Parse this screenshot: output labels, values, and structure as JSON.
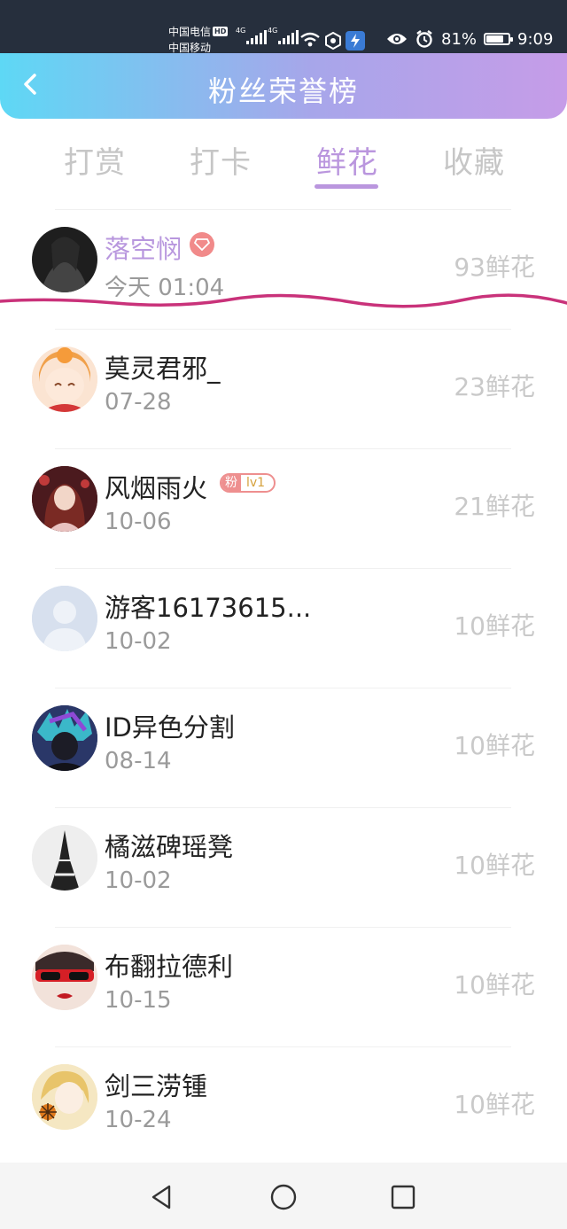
{
  "status_bar": {
    "carrier_1": "中国电信",
    "hd": "HD",
    "carrier_2": "中国移动",
    "net_1": "4G",
    "net_2": "4G",
    "battery": "81%",
    "battery_level": 0.81,
    "time": "9:09"
  },
  "header": {
    "title": "粉丝荣誉榜"
  },
  "tabs": [
    {
      "label": "打赏",
      "active": false
    },
    {
      "label": "打卡",
      "active": false
    },
    {
      "label": "鲜花",
      "active": true
    },
    {
      "label": "收藏",
      "active": false
    }
  ],
  "fans": [
    {
      "name": "落空悯",
      "date": "今天 01:04",
      "count": "93鲜花",
      "highlight": true,
      "badge": "diamond"
    },
    {
      "name": "莫灵君邪_",
      "date": "07-28",
      "count": "23鲜花"
    },
    {
      "name": "风烟雨火",
      "date": "10-06",
      "count": "21鲜花",
      "badge": "fan",
      "badge_left": "粉",
      "badge_right": "lv1"
    },
    {
      "name": "游客16173615...",
      "date": "10-02",
      "count": "10鲜花"
    },
    {
      "name": "ID异色分割",
      "date": "08-14",
      "count": "10鲜花"
    },
    {
      "name": "橘滋碑瑶凳",
      "date": "10-02",
      "count": "10鲜花"
    },
    {
      "name": "布翻拉德利",
      "date": "10-15",
      "count": "10鲜花"
    },
    {
      "name": "剑三涝锺",
      "date": "10-24",
      "count": "10鲜花"
    }
  ],
  "colors": {
    "accent": "#ba96de",
    "header_start": "#5ed8f5",
    "header_end": "#c69ce8",
    "annotation_line": "#c9327a"
  }
}
